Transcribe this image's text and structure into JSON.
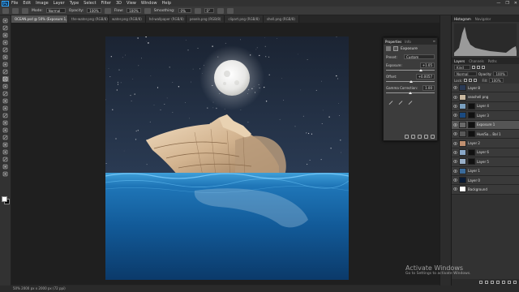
{
  "menubar": {
    "logo": "Ps",
    "items": [
      "File",
      "Edit",
      "Image",
      "Layer",
      "Type",
      "Select",
      "Filter",
      "3D",
      "View",
      "Window",
      "Help"
    ],
    "window_controls": [
      "—",
      "❐",
      "✕"
    ]
  },
  "options": {
    "mode_label": "Mode:",
    "mode_value": "Normal",
    "opacity_label": "Opacity:",
    "opacity_value": "100%",
    "flow_label": "Flow:",
    "flow_value": "100%",
    "smoothing_label": "Smoothing:",
    "smoothing_value": "0%",
    "angle_value": "0°"
  },
  "tabs": [
    {
      "label": "OCEAN.psd @ 50% (Exposure 1, RGB/8)",
      "active": true
    },
    {
      "label": "the-water.png (RGB/8)",
      "active": false
    },
    {
      "label": "water.png (RGB/8)",
      "active": false
    },
    {
      "label": "hd-wallpaper (RGB/8)",
      "active": false
    },
    {
      "label": "pexels.png (RGB/8)",
      "active": false
    },
    {
      "label": "clipart.png (RGB/8)",
      "active": false
    },
    {
      "label": "shell.png (RGB/8)",
      "active": false
    }
  ],
  "properties": {
    "tabs": [
      "Properties",
      "Info"
    ],
    "title": "Exposure",
    "preset_label": "Preset:",
    "preset_value": "Custom",
    "rows": [
      {
        "label": "Exposure:",
        "value": "+1.05",
        "slider": 0.72
      },
      {
        "label": "Offset:",
        "value": "+0.0057",
        "slider": 0.52
      },
      {
        "label": "Gamma Correction:",
        "value": "1.00",
        "slider": 0.5
      }
    ]
  },
  "histogram_panel": {
    "tabs": [
      "Histogram",
      "Navigator"
    ]
  },
  "layers_panel": {
    "tabs": [
      "Layers",
      "Channels",
      "Paths"
    ],
    "kind_label": "Kind",
    "blend_mode": "Normal",
    "opacity_label": "Opacity:",
    "opacity_value": "100%",
    "lock_label": "Lock:",
    "fill_label": "Fill:",
    "fill_value": "100%",
    "layers": [
      {
        "name": "Layer 8",
        "thumb": "#2a3a55",
        "mask": false,
        "active": false
      },
      {
        "name": "seashell png",
        "thumb": "#c9b8a0",
        "mask": false,
        "active": false
      },
      {
        "name": "Layer 4",
        "thumb": "#7aa0c0",
        "mask": true,
        "active": false
      },
      {
        "name": "Layer 3",
        "thumb": "#1a4a80",
        "mask": true,
        "active": false
      },
      {
        "name": "Exposure 1",
        "thumb": "#6a6a6a",
        "mask": true,
        "active": true
      },
      {
        "name": "Hue/Sa... Bal 1",
        "thumb": "#585858",
        "mask": true,
        "active": false
      },
      {
        "name": "Layer 2",
        "thumb": "#c09070",
        "mask": false,
        "active": false
      },
      {
        "name": "Layer 6",
        "thumb": "#8aa8c8",
        "mask": true,
        "active": false
      },
      {
        "name": "Layer 5",
        "thumb": "#9ab0c8",
        "mask": true,
        "active": false
      },
      {
        "name": "Layer 1",
        "thumb": "#3a6a9a",
        "mask": false,
        "active": false
      },
      {
        "name": "Layer 0",
        "thumb": "#0a1a33",
        "mask": false,
        "active": false
      },
      {
        "name": "Background",
        "thumb": "#ffffff",
        "mask": false,
        "active": false
      }
    ]
  },
  "statusbar": {
    "text": "50%     2000 px x 2000 px (72 ppi)"
  },
  "watermark": {
    "line1": "Activate Windows",
    "line2": "Go to Settings to activate Windows."
  },
  "colors": {
    "accent": "#31a8ff",
    "canvas_bg": "#1f1f1f"
  }
}
